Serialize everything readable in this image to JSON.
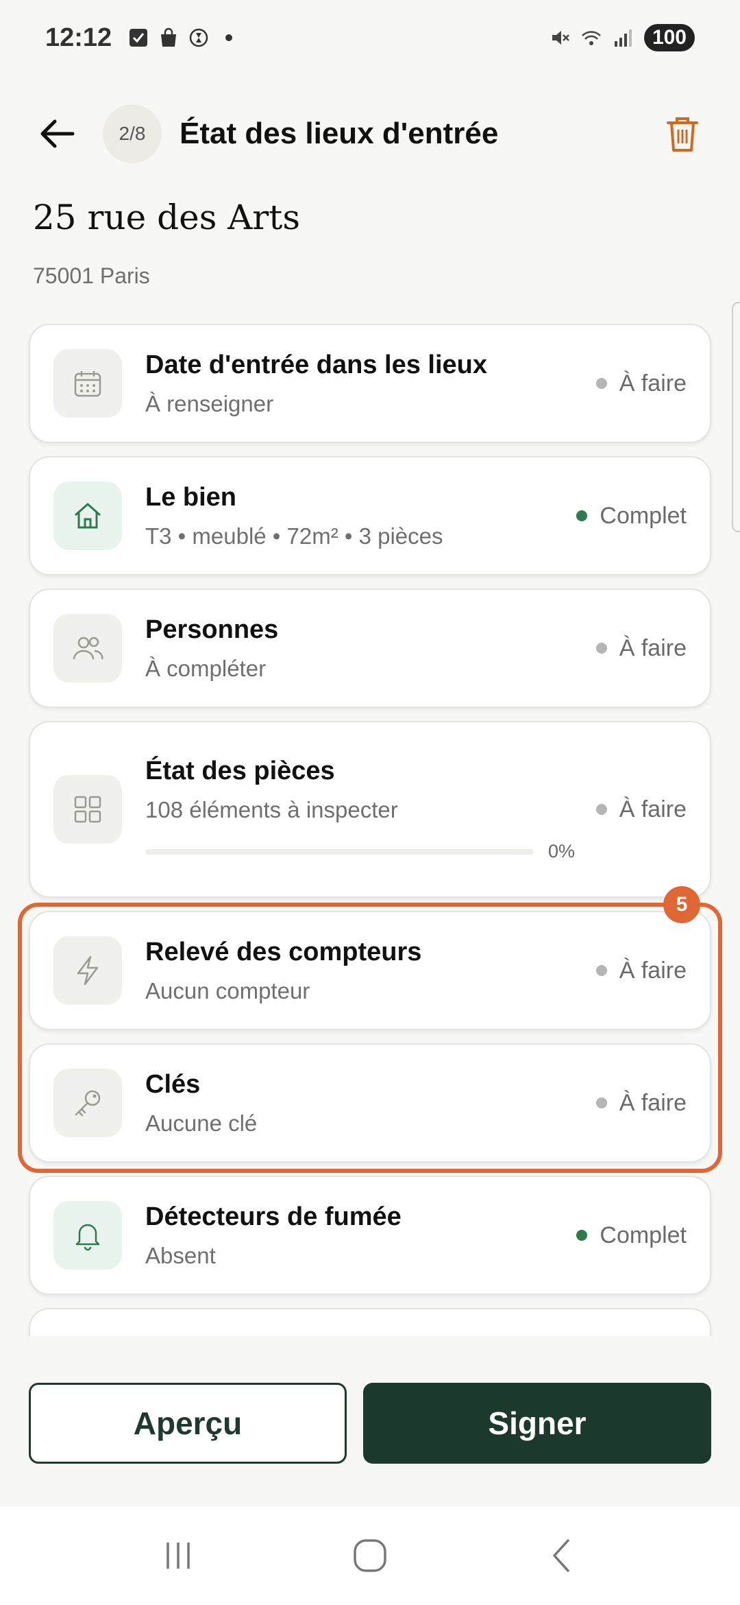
{
  "status_bar": {
    "time": "12:12",
    "battery": "100",
    "icons_left": [
      "checkbox-icon",
      "bag-icon",
      "timer-icon",
      "dot-icon"
    ],
    "icons_right": [
      "mute-icon",
      "wifi-icon",
      "signal-icon"
    ]
  },
  "header": {
    "step": "2/8",
    "title": "État des lieux d'entrée"
  },
  "address": {
    "street": "25 rue des Arts",
    "city": "75001 Paris"
  },
  "sections": [
    {
      "title": "Date d'entrée dans les lieux",
      "subtitle": "À renseigner",
      "status": "À faire",
      "complete": false,
      "icon": "calendar-icon"
    },
    {
      "title": "Le bien",
      "subtitle": "T3 • meublé • 72m² • 3 pièces",
      "status": "Complet",
      "complete": true,
      "icon": "home-icon"
    },
    {
      "title": "Personnes",
      "subtitle": "À compléter",
      "status": "À faire",
      "complete": false,
      "icon": "people-icon"
    },
    {
      "title": "État des pièces",
      "subtitle": "108 éléments à inspecter",
      "status": "À faire",
      "complete": false,
      "icon": "grid-icon",
      "progress": 0,
      "progress_label": "0%"
    },
    {
      "title": "Relevé des compteurs",
      "subtitle": "Aucun compteur",
      "status": "À faire",
      "complete": false,
      "icon": "lightning-icon"
    },
    {
      "title": "Clés",
      "subtitle": "Aucune clé",
      "status": "À faire",
      "complete": false,
      "icon": "key-icon"
    },
    {
      "title": "Détecteurs de fumée",
      "subtitle": "Absent",
      "status": "Complet",
      "complete": true,
      "icon": "bell-icon"
    }
  ],
  "highlight": {
    "badge": "5",
    "color": "#e06634"
  },
  "actions": {
    "preview_label": "Aperçu",
    "sign_label": "Signer"
  },
  "colors": {
    "accent_green": "#2e7a4f",
    "dark_green": "#1b3a2c",
    "todo_gray": "#b5b5b5",
    "trash": "#d2691e"
  }
}
